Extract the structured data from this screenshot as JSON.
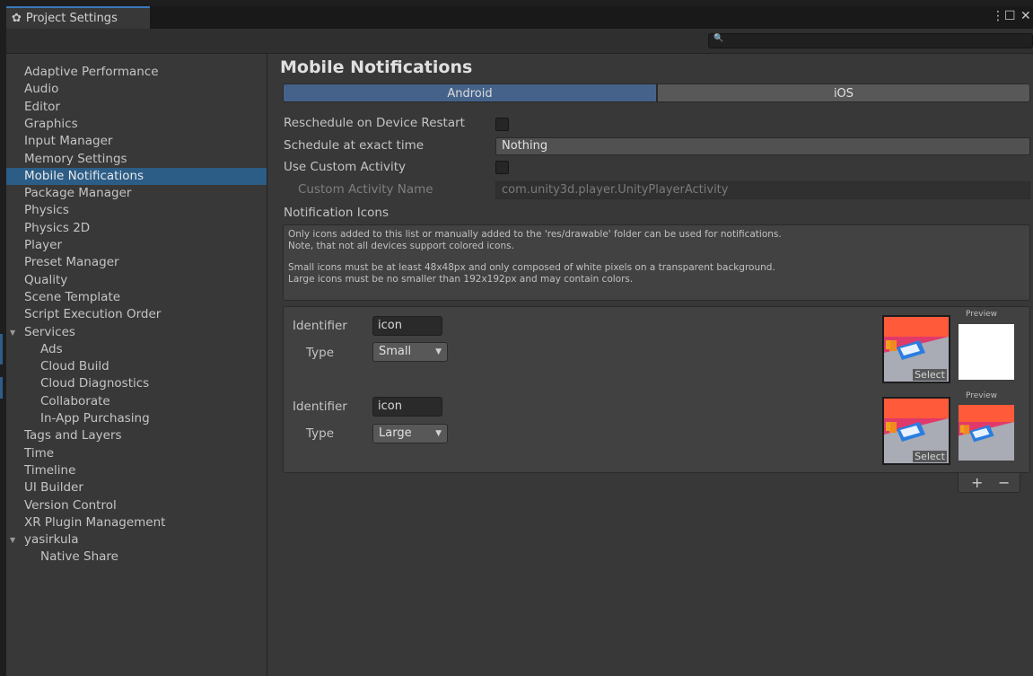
{
  "window": {
    "tab_title": "Project Settings",
    "controls": [
      "⋮",
      "☐",
      "✕"
    ]
  },
  "search": {
    "placeholder": ""
  },
  "sidebar": {
    "items": [
      {
        "label": "Adaptive Performance",
        "indent": 0,
        "selected": false
      },
      {
        "label": "Audio",
        "indent": 0,
        "selected": false
      },
      {
        "label": "Editor",
        "indent": 0,
        "selected": false
      },
      {
        "label": "Graphics",
        "indent": 0,
        "selected": false
      },
      {
        "label": "Input Manager",
        "indent": 0,
        "selected": false
      },
      {
        "label": "Memory Settings",
        "indent": 0,
        "selected": false
      },
      {
        "label": "Mobile Notifications",
        "indent": 0,
        "selected": true
      },
      {
        "label": "Package Manager",
        "indent": 0,
        "selected": false
      },
      {
        "label": "Physics",
        "indent": 0,
        "selected": false
      },
      {
        "label": "Physics 2D",
        "indent": 0,
        "selected": false
      },
      {
        "label": "Player",
        "indent": 0,
        "selected": false
      },
      {
        "label": "Preset Manager",
        "indent": 0,
        "selected": false
      },
      {
        "label": "Quality",
        "indent": 0,
        "selected": false
      },
      {
        "label": "Scene Template",
        "indent": 0,
        "selected": false
      },
      {
        "label": "Script Execution Order",
        "indent": 0,
        "selected": false
      },
      {
        "label": "Services",
        "indent": 0,
        "selected": false,
        "expanded": true
      },
      {
        "label": "Ads",
        "indent": 1,
        "selected": false
      },
      {
        "label": "Cloud Build",
        "indent": 1,
        "selected": false
      },
      {
        "label": "Cloud Diagnostics",
        "indent": 1,
        "selected": false
      },
      {
        "label": "Collaborate",
        "indent": 1,
        "selected": false
      },
      {
        "label": "In-App Purchasing",
        "indent": 1,
        "selected": false
      },
      {
        "label": "Tags and Layers",
        "indent": 0,
        "selected": false
      },
      {
        "label": "Time",
        "indent": 0,
        "selected": false
      },
      {
        "label": "Timeline",
        "indent": 0,
        "selected": false
      },
      {
        "label": "UI Builder",
        "indent": 0,
        "selected": false
      },
      {
        "label": "Version Control",
        "indent": 0,
        "selected": false
      },
      {
        "label": "XR Plugin Management",
        "indent": 0,
        "selected": false
      },
      {
        "label": "yasirkula",
        "indent": 0,
        "selected": false,
        "expanded": true
      },
      {
        "label": "Native Share",
        "indent": 1,
        "selected": false
      }
    ]
  },
  "main": {
    "title": "Mobile Notifications",
    "tabs": [
      {
        "label": "Android",
        "active": true
      },
      {
        "label": "iOS",
        "active": false
      }
    ],
    "fields": {
      "reschedule_label": "Reschedule on Device Restart",
      "reschedule_checked": false,
      "exact_time_label": "Schedule at exact time",
      "exact_time_value": "Nothing",
      "custom_activity_label": "Use Custom Activity",
      "custom_activity_checked": false,
      "custom_activity_name_label": "Custom Activity Name",
      "custom_activity_name_value": "com.unity3d.player.UnityPlayerActivity"
    },
    "icons_section": {
      "label": "Notification Icons",
      "help_line1": "Only icons added to this list or manually added to the 'res/drawable' folder can be used for notifications.",
      "help_line2": "Note, that not all devices support colored icons.",
      "help_line3": "Small icons must be at least 48x48px and only composed of white pixels on a transparent background.",
      "help_line4": "Large icons must be no smaller than 192x192px and may contain colors.",
      "entries": [
        {
          "identifier_label": "Identifier",
          "identifier_value": "icon",
          "type_label": "Type",
          "type_value": "Small",
          "select_label": "Select",
          "preview_label": "Preview"
        },
        {
          "identifier_label": "Identifier",
          "identifier_value": "icon",
          "type_label": "Type",
          "type_value": "Large",
          "select_label": "Select",
          "preview_label": "Preview"
        }
      ],
      "add_label": "+",
      "remove_label": "−"
    }
  },
  "colors": {
    "accent_selected": "#2c5d87",
    "tab_active": "#45628a",
    "window_bg": "#383838"
  }
}
